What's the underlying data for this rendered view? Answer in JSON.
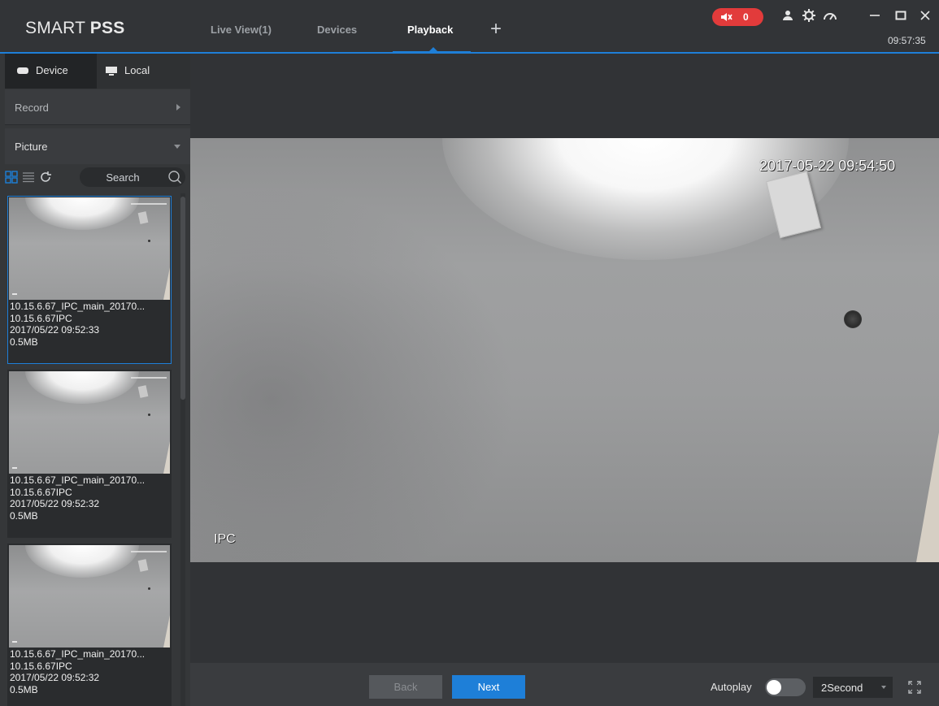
{
  "app": {
    "logo_light": "SMART ",
    "logo_bold": "PSS"
  },
  "tabs": [
    {
      "label": "Live View(1)"
    },
    {
      "label": "Devices"
    },
    {
      "label": "Playback"
    }
  ],
  "active_tab": "Playback",
  "titlebar": {
    "alarm_count": "0",
    "clock": "09:57:35",
    "accent_color": "#1e7fd8",
    "alarm_color": "#e23b3b"
  },
  "sidebar": {
    "source_tabs": [
      {
        "label": "Device",
        "icon": "hard-drive-icon"
      },
      {
        "label": "Local",
        "icon": "monitor-icon"
      }
    ],
    "sections": [
      {
        "label": "Record"
      },
      {
        "label": "Picture"
      }
    ],
    "search_placeholder": "Search",
    "items": [
      {
        "name": "10.15.6.67_IPC_main_20170...",
        "channel": "10.15.6.67IPC",
        "time": "2017/05/22 09:52:33",
        "size": "0.5MB",
        "selected": true
      },
      {
        "name": "10.15.6.67_IPC_main_20170...",
        "channel": "10.15.6.67IPC",
        "time": "2017/05/22 09:52:32",
        "size": "0.5MB",
        "selected": false
      },
      {
        "name": "10.15.6.67_IPC_main_20170...",
        "channel": "10.15.6.67IPC",
        "time": "2017/05/22 09:52:32",
        "size": "0.5MB",
        "selected": false
      }
    ]
  },
  "viewer": {
    "timestamp": "2017-05-22 09:54:50",
    "channel_label": "IPC"
  },
  "controls": {
    "back_label": "Back",
    "next_label": "Next",
    "autoplay_label": "Autoplay",
    "autoplay_on": false,
    "interval": "2Second"
  }
}
